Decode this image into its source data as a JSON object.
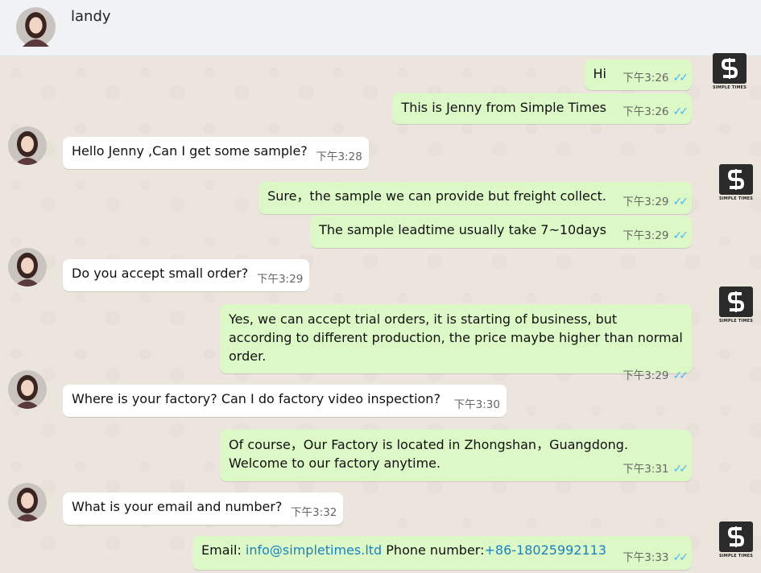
{
  "header": {
    "contact_name": "landy"
  },
  "brand": {
    "caption": "SIMPLE TIMES",
    "letter": "S"
  },
  "messages": {
    "m1": {
      "text": "Hi",
      "time": "下午3:26",
      "status": "read"
    },
    "m2": {
      "text": "This is Jenny from Simple Times",
      "time": "下午3:26",
      "status": "read"
    },
    "m3": {
      "text": "Hello Jenny ,Can I get some sample?",
      "time": "下午3:28"
    },
    "m4": {
      "text": "Sure，the sample we can provide but freight collect.",
      "time": "下午3:29",
      "status": "read"
    },
    "m5": {
      "text": "The sample leadtime usually take 7~10days",
      "time": "下午3:29",
      "status": "read"
    },
    "m6": {
      "text": "Do you accept small order?",
      "time": "下午3:29"
    },
    "m7": {
      "text": "Yes, we can accept trial orders, it is starting of business, but according to different production, the price maybe higher than normal order.",
      "time": "下午3:29",
      "status": "read"
    },
    "m8": {
      "text": "Where is your factory?  Can I do factory video inspection?",
      "time": "下午3:30"
    },
    "m9": {
      "text": "Of course，Our Factory is located in Zhongshan，Guangdong. Welcome to our factory anytime.",
      "time": "下午3:31",
      "status": "read"
    },
    "m10": {
      "text": "What is your email and number?",
      "time": "下午3:32"
    },
    "m11": {
      "label_email": "Email: ",
      "email": "info@simpletimes.ltd",
      "label_phone": " Phone number:",
      "phone": "+86-18025992113",
      "time": "下午3:33",
      "status": "read"
    }
  },
  "colors": {
    "incoming": "#ffffff",
    "outgoing": "#dcf8c6",
    "ticks": "#4fb6ec",
    "link": "#1a82c4"
  }
}
